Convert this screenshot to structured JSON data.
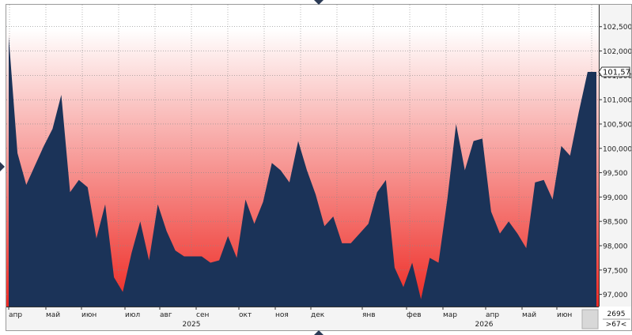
{
  "chart_data": {
    "type": "area",
    "series": [
      {
        "values": [
          102.3,
          99.9,
          99.25,
          99.65,
          100.05,
          100.4,
          101.1,
          99.1,
          99.35,
          99.2,
          98.15,
          98.85,
          97.35,
          97.05,
          97.85,
          98.5,
          97.7,
          98.85,
          98.3,
          97.9,
          97.78,
          97.78,
          97.78,
          97.65,
          97.7,
          98.2,
          97.75,
          98.95,
          98.45,
          98.9,
          99.7,
          99.55,
          99.3,
          100.15,
          99.55,
          99.05,
          98.4,
          98.6,
          98.05,
          98.05,
          98.25,
          98.45,
          99.1,
          99.35,
          97.55,
          97.15,
          97.65,
          96.9,
          97.75,
          97.65,
          98.95,
          100.5,
          99.55,
          100.15,
          100.2,
          98.7,
          98.25,
          98.5,
          98.25,
          97.95,
          99.3,
          99.35,
          98.95,
          100.05,
          99.85,
          100.75,
          101.571,
          101.571
        ]
      }
    ],
    "y_ticks": [
      "97,000",
      "97,500",
      "98,000",
      "98,500",
      "99,000",
      "99,500",
      "100,000",
      "100,500",
      "101,000",
      "101,500",
      "102,000",
      "102,500"
    ],
    "ylim": [
      96.75,
      102.95
    ],
    "month_labels": [
      "апр",
      "май",
      "июн",
      "июл",
      "авг",
      "сен",
      "окт",
      "ноя",
      "дек",
      "янв",
      "фев",
      "мар",
      "апр",
      "май",
      "июн"
    ],
    "year_labels": [
      "2025",
      "2026"
    ],
    "last_value_label": "101,571",
    "grid": true,
    "colors": {
      "area_fill": "#1b3358",
      "background_top": "#ffffff",
      "background_bottom": "#ee2a24",
      "axis_panel": "#f5f5f5"
    }
  },
  "footer": {
    "counter_top": "2695",
    "counter_bottom": ">67<"
  }
}
